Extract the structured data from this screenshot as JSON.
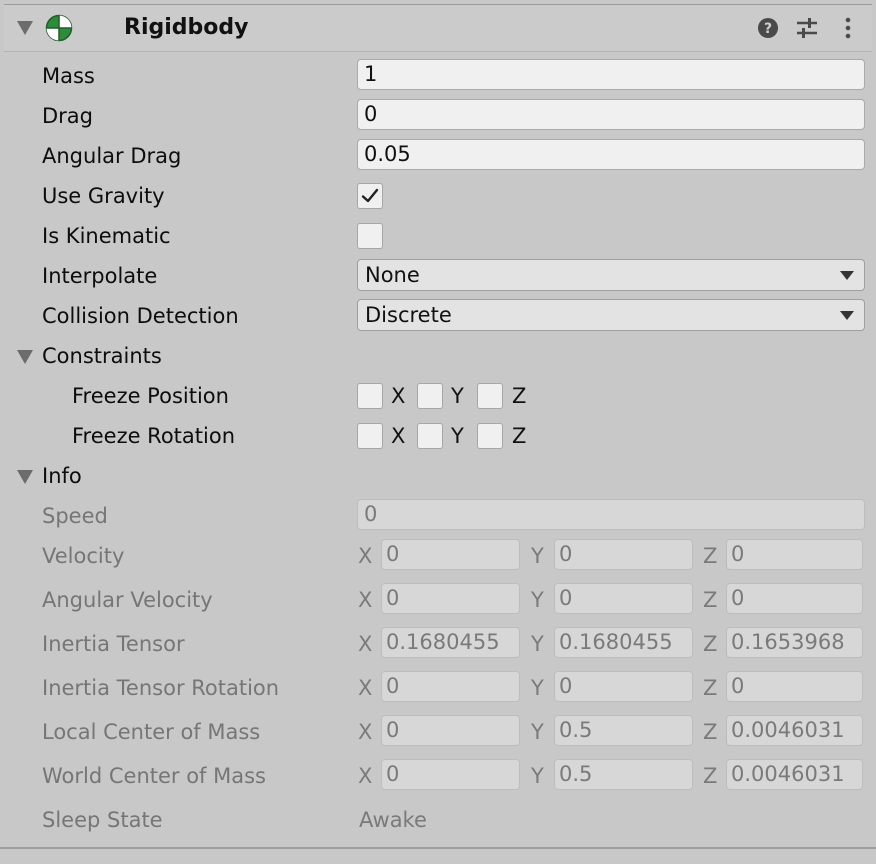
{
  "header": {
    "title": "Rigidbody"
  },
  "props": {
    "mass": {
      "label": "Mass",
      "value": "1"
    },
    "drag": {
      "label": "Drag",
      "value": "0"
    },
    "angular_drag": {
      "label": "Angular Drag",
      "value": "0.05"
    },
    "use_gravity": {
      "label": "Use Gravity",
      "checked": true
    },
    "is_kinematic": {
      "label": "Is Kinematic",
      "checked": false
    },
    "interpolate": {
      "label": "Interpolate",
      "value": "None"
    },
    "collision_detection": {
      "label": "Collision Detection",
      "value": "Discrete"
    }
  },
  "constraints": {
    "label": "Constraints",
    "freeze_position": {
      "label": "Freeze Position",
      "x": "X",
      "y": "Y",
      "z": "Z"
    },
    "freeze_rotation": {
      "label": "Freeze Rotation",
      "x": "X",
      "y": "Y",
      "z": "Z"
    }
  },
  "info": {
    "label": "Info",
    "speed": {
      "label": "Speed",
      "value": "0"
    },
    "velocity": {
      "label": "Velocity",
      "x": "0",
      "y": "0",
      "z": "0"
    },
    "angular_velocity": {
      "label": "Angular Velocity",
      "x": "0",
      "y": "0",
      "z": "0"
    },
    "inertia_tensor": {
      "label": "Inertia Tensor",
      "x": "0.1680455",
      "y": "0.1680455",
      "z": "0.1653968"
    },
    "inertia_tensor_rotation": {
      "label": "Inertia Tensor Rotation",
      "x": "0",
      "y": "0",
      "z": "0"
    },
    "local_center_of_mass": {
      "label": "Local Center of Mass",
      "x": "0",
      "y": "0.5",
      "z": "0.0046031"
    },
    "world_center_of_mass": {
      "label": "World Center of Mass",
      "x": "0",
      "y": "0.5",
      "z": "0.0046031"
    },
    "sleep_state": {
      "label": "Sleep State",
      "value": "Awake"
    },
    "axis_labels": {
      "x": "X",
      "y": "Y",
      "z": "Z"
    }
  },
  "colors": {
    "rigidbody_icon_green": "#2e8b3c",
    "background": "#c8c8c8"
  },
  "icons": [
    "foldout-arrow-icon",
    "rigidbody-icon",
    "help-icon",
    "preset-icon",
    "kebab-menu-icon",
    "checkmark-icon",
    "dropdown-arrow-icon"
  ]
}
